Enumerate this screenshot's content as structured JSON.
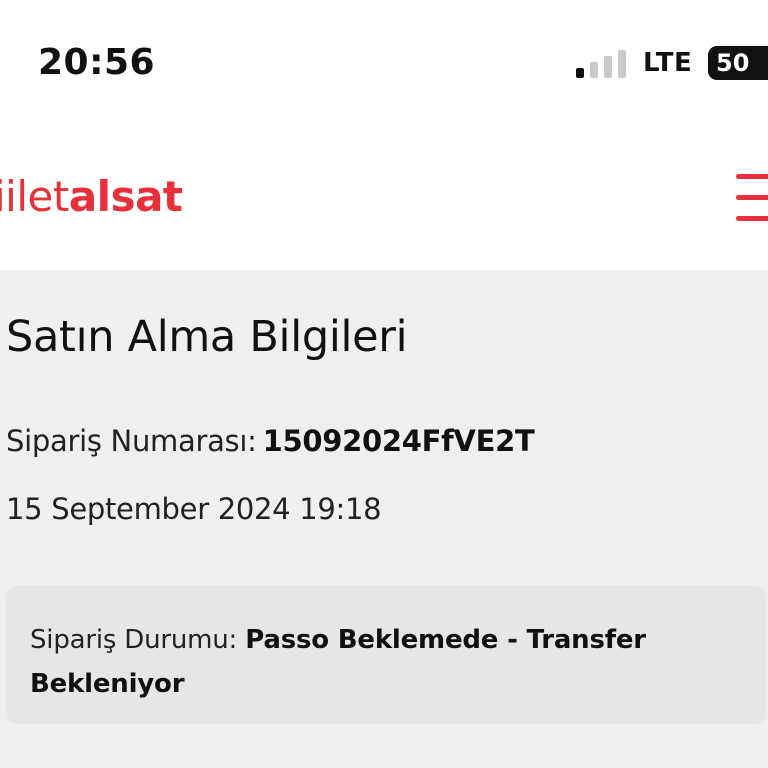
{
  "status_bar": {
    "time": "20:56",
    "network": "LTE",
    "battery": "50",
    "signal_bars_active": 1,
    "signal_bars_total": 4
  },
  "header": {
    "logo_part1": "iilet",
    "logo_part2": "alsat",
    "brand_color": "#e8303a",
    "menu_icon": "hamburger-menu-icon"
  },
  "purchase_info": {
    "title": "Satın Alma Bilgileri",
    "order_number_label": "Sipariş Numarası:",
    "order_number_value": "15092024FfVE2T",
    "date": "15 September 2024 19:18",
    "order_status_label": "Sipariş Durumu:",
    "order_status_value": "Passo Beklemede - Transfer Bekleniyor"
  }
}
